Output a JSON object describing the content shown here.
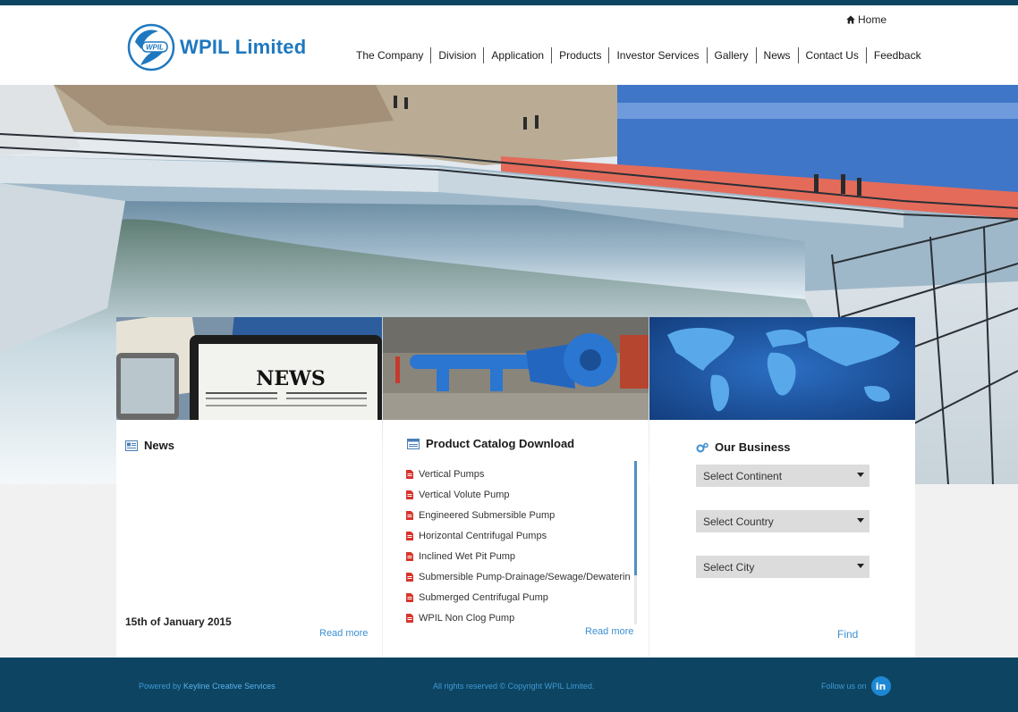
{
  "brand": {
    "name": "WPIL Limited",
    "emblem_text": "WPIL",
    "color": "#1f78bf"
  },
  "header": {
    "home_label": "Home",
    "nav": [
      "The Company",
      "Division",
      "Application",
      "Products",
      "Investor Services",
      "Gallery",
      "News",
      "Contact Us",
      "Feedback"
    ]
  },
  "hero": {
    "image_subject": "dam-spillway-photo"
  },
  "news_panel": {
    "title": "News",
    "date": "15th of January 2015",
    "read_more": "Read more",
    "thumb_text": "NEWS"
  },
  "catalog_panel": {
    "title": "Product Catalog Download",
    "items": [
      "Vertical Pumps",
      "Vertical Volute Pump",
      "Engineered Submersible Pump",
      "Horizontal Centrifugal Pumps",
      "Inclined Wet Pit Pump",
      "Submersible Pump-Drainage/Sewage/Dewaterin",
      "Submerged Centrifugal Pump",
      "WPIL Non Clog Pump"
    ],
    "read_more": "Read more"
  },
  "business_panel": {
    "title": "Our Business",
    "continent_placeholder": "Select Continent",
    "country_placeholder": "Select Country",
    "city_placeholder": "Select City",
    "find_label": "Find"
  },
  "footer": {
    "powered_prefix": "Powered by",
    "powered_name": "Keyline Creative Services",
    "copyright": "All rights reserved © Copyright WPIL Limited.",
    "follow_label": "Follow us on",
    "social_icon": "in"
  },
  "colors": {
    "dark_blue": "#0d4461",
    "link_blue": "#3d8fd0",
    "accent_blue": "#1f78bf"
  }
}
